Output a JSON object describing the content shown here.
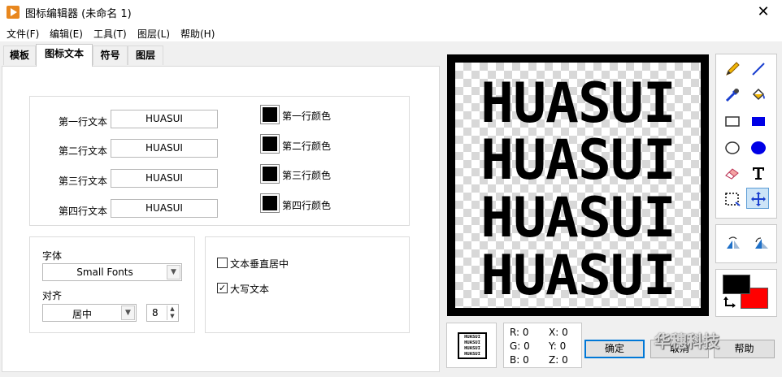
{
  "window": {
    "title": "图标编辑器 (未命名 1)",
    "close": "✕"
  },
  "menu": [
    {
      "label": "文件(F)"
    },
    {
      "label": "编辑(E)"
    },
    {
      "label": "工具(T)"
    },
    {
      "label": "图层(L)"
    },
    {
      "label": "帮助(H)"
    }
  ],
  "tabs": [
    {
      "label": "模板",
      "active": false
    },
    {
      "label": "图标文本",
      "active": true
    },
    {
      "label": "符号",
      "active": false
    },
    {
      "label": "图层",
      "active": false
    }
  ],
  "lines": [
    {
      "label": "第一行文本",
      "value": "HUASUI",
      "color_label": "第一行颜色",
      "color": "#000000"
    },
    {
      "label": "第二行文本",
      "value": "HUASUI",
      "color_label": "第二行颜色",
      "color": "#000000"
    },
    {
      "label": "第三行文本",
      "value": "HUASUI",
      "color_label": "第三行颜色",
      "color": "#000000"
    },
    {
      "label": "第四行文本",
      "value": "HUASUI",
      "color_label": "第四行颜色",
      "color": "#000000"
    }
  ],
  "font": {
    "label": "字体",
    "value": "Small Fonts"
  },
  "align": {
    "label": "对齐",
    "value": "居中",
    "size": "8"
  },
  "options": {
    "vcenter": {
      "label": "文本垂直居中",
      "checked": false
    },
    "uppercase": {
      "label": "大写文本",
      "checked": true
    }
  },
  "canvas": {
    "lines": [
      "HUASUI",
      "HUASUI",
      "HUASUI",
      "HUASUI"
    ]
  },
  "tools": [
    "pencil-icon",
    "line-icon",
    "color-picker-icon",
    "fill-bucket-icon",
    "rectangle-icon",
    "filled-rectangle-icon",
    "ellipse-icon",
    "filled-ellipse-icon",
    "eraser-icon",
    "text-tool-icon",
    "selection-icon",
    "move-icon"
  ],
  "colors": {
    "foreground": "#000000",
    "background": "#ff0000"
  },
  "readout": {
    "r": "R: 0",
    "g": "G: 0",
    "b": "B: 0",
    "x": "X: 0",
    "y": "Y: 0",
    "z": "Z: 0"
  },
  "buttons": {
    "ok": "确定",
    "cancel": "取消",
    "help": "帮助"
  },
  "watermark": "华穗科技"
}
